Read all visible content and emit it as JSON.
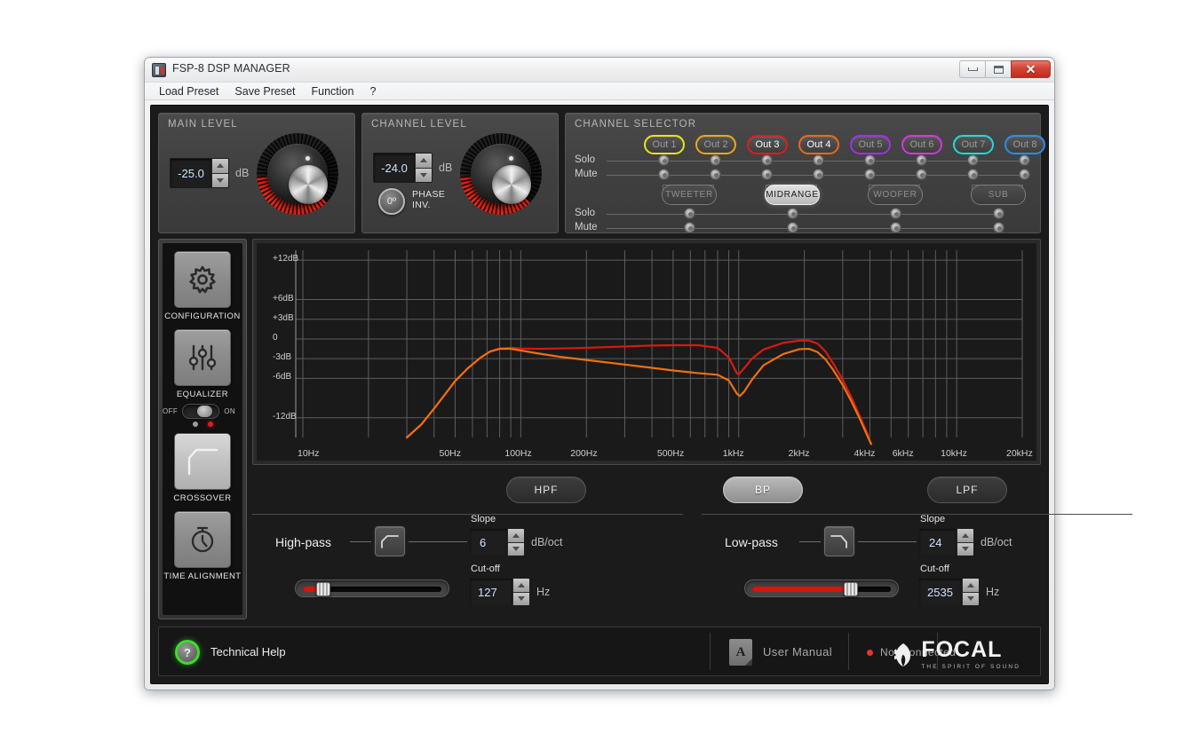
{
  "window": {
    "title": "FSP-8 DSP MANAGER",
    "icon": "app-icon",
    "controls": {
      "minimize": "minimize",
      "maximize": "maximize",
      "close": "✕"
    }
  },
  "menu": {
    "items": [
      "Load Preset",
      "Save Preset",
      "Function",
      "?"
    ]
  },
  "main_level": {
    "title": "MAIN LEVEL",
    "value": "-25.0",
    "unit": "dB"
  },
  "channel_level": {
    "title": "CHANNEL LEVEL",
    "value": "-24.0",
    "unit": "dB",
    "phase_value": "0º",
    "phase_label_line1": "PHASE",
    "phase_label_line2": "INV."
  },
  "channel_selector": {
    "title": "CHANNEL SELECTOR",
    "solo_label": "Solo",
    "mute_label": "Mute",
    "outputs": [
      {
        "label": "Out 1",
        "color": "#e8e21a",
        "active": false
      },
      {
        "label": "Out 2",
        "color": "#e8a81a",
        "active": false
      },
      {
        "label": "Out 3",
        "color": "#e01b1b",
        "active": true
      },
      {
        "label": "Out 4",
        "color": "#e86a18",
        "active": true
      },
      {
        "label": "Out 5",
        "color": "#a030e8",
        "active": false
      },
      {
        "label": "Out 6",
        "color": "#d634e0",
        "active": false
      },
      {
        "label": "Out 7",
        "color": "#1fd8e0",
        "active": false
      },
      {
        "label": "Out 8",
        "color": "#2a8de8",
        "active": false
      }
    ],
    "speakers": [
      {
        "label": "TWEETER",
        "active": false
      },
      {
        "label": "MIDRANGE",
        "active": true
      },
      {
        "label": "WOOFER",
        "active": false
      },
      {
        "label": "SUB",
        "active": false
      }
    ]
  },
  "sidebar": {
    "items": [
      {
        "label": "CONFIGURATION",
        "icon": "gear-icon",
        "selected": false
      },
      {
        "label": "EQUALIZER",
        "icon": "sliders-icon",
        "selected": false
      },
      {
        "label": "CROSSOVER",
        "icon": "crossover-curve-icon",
        "selected": true
      },
      {
        "label": "TIME ALIGNMENT",
        "icon": "stopwatch-icon",
        "selected": false
      }
    ],
    "eq_toggle": {
      "off_label": "OFF",
      "on_label": "ON",
      "state": "off"
    }
  },
  "chart_data": {
    "type": "line",
    "title": "",
    "xlabel": "",
    "ylabel": "",
    "grid": true,
    "x_scale": "log",
    "xlim": [
      10,
      20000
    ],
    "ylim": [
      -15,
      13.5
    ],
    "x_ticks": [
      "10Hz",
      "50Hz",
      "100Hz",
      "200Hz",
      "500Hz",
      "1kHz",
      "2kHz",
      "4kHz",
      "6kHz",
      "10kHz",
      "20kHz"
    ],
    "x_tick_values": [
      10,
      50,
      100,
      200,
      500,
      1000,
      2000,
      4000,
      6000,
      10000,
      20000
    ],
    "y_ticks": [
      "+12dB",
      "+6dB",
      "+3dB",
      "0",
      "-3dB",
      "-6dB",
      "-12dB"
    ],
    "y_tick_values": [
      12,
      6,
      3,
      0,
      -3,
      -6,
      -12
    ],
    "series": [
      {
        "name": "Out 3",
        "color": "#d81a10",
        "points": [
          [
            30,
            -15.0
          ],
          [
            35,
            -13.0
          ],
          [
            40,
            -10.6
          ],
          [
            45,
            -8.4
          ],
          [
            50,
            -6.4
          ],
          [
            57,
            -4.5
          ],
          [
            65,
            -2.9
          ],
          [
            72,
            -1.9
          ],
          [
            80,
            -1.45
          ],
          [
            90,
            -1.35
          ],
          [
            100,
            -1.45
          ],
          [
            120,
            -1.5
          ],
          [
            150,
            -1.45
          ],
          [
            200,
            -1.35
          ],
          [
            300,
            -1.15
          ],
          [
            400,
            -1.0
          ],
          [
            500,
            -0.95
          ],
          [
            650,
            -0.95
          ],
          [
            800,
            -1.35
          ],
          [
            900,
            -2.8
          ],
          [
            980,
            -5.2
          ],
          [
            1000,
            -5.4
          ],
          [
            1050,
            -4.6
          ],
          [
            1150,
            -3.0
          ],
          [
            1300,
            -1.6
          ],
          [
            1600,
            -0.6
          ],
          [
            1900,
            -0.25
          ],
          [
            2100,
            -0.25
          ],
          [
            2300,
            -0.7
          ],
          [
            2500,
            -1.9
          ],
          [
            2700,
            -3.6
          ],
          [
            3000,
            -6.2
          ],
          [
            3300,
            -9.0
          ],
          [
            3600,
            -11.8
          ],
          [
            3900,
            -14.5
          ],
          [
            4050,
            -16.0
          ]
        ]
      },
      {
        "name": "Out 4",
        "color": "#f07010",
        "points": [
          [
            30,
            -15.0
          ],
          [
            35,
            -13.0
          ],
          [
            40,
            -10.6
          ],
          [
            45,
            -8.4
          ],
          [
            50,
            -6.4
          ],
          [
            57,
            -4.5
          ],
          [
            65,
            -2.9
          ],
          [
            72,
            -1.95
          ],
          [
            80,
            -1.5
          ],
          [
            90,
            -1.5
          ],
          [
            100,
            -1.75
          ],
          [
            120,
            -2.2
          ],
          [
            150,
            -2.7
          ],
          [
            200,
            -3.2
          ],
          [
            300,
            -3.9
          ],
          [
            400,
            -4.4
          ],
          [
            500,
            -4.8
          ],
          [
            650,
            -5.2
          ],
          [
            800,
            -5.45
          ],
          [
            900,
            -6.3
          ],
          [
            980,
            -8.3
          ],
          [
            1010,
            -8.7
          ],
          [
            1060,
            -8.0
          ],
          [
            1150,
            -6.2
          ],
          [
            1300,
            -4.0
          ],
          [
            1600,
            -2.3
          ],
          [
            1900,
            -1.55
          ],
          [
            2100,
            -1.5
          ],
          [
            2300,
            -2.0
          ],
          [
            2500,
            -3.1
          ],
          [
            2700,
            -4.6
          ],
          [
            3000,
            -7.0
          ],
          [
            3300,
            -9.6
          ],
          [
            3600,
            -12.2
          ],
          [
            3900,
            -14.8
          ],
          [
            4050,
            -16.0
          ]
        ]
      }
    ]
  },
  "filter_buttons": [
    {
      "label": "HPF",
      "active": false
    },
    {
      "label": "BP",
      "active": true
    },
    {
      "label": "LPF",
      "active": false
    }
  ],
  "highpass": {
    "label": "High-pass",
    "icon": "highpass-slope-icon",
    "slope_label": "Slope",
    "slope_value": "6",
    "slope_unit": "dB/oct",
    "cutoff_label": "Cut-off",
    "cutoff_value": "127",
    "cutoff_unit": "Hz",
    "slider_position": 12
  },
  "lowpass": {
    "label": "Low-pass",
    "icon": "lowpass-slope-icon",
    "slope_label": "Slope",
    "slope_value": "24",
    "slope_unit": "dB/oct",
    "cutoff_label": "Cut-off",
    "cutoff_value": "2535",
    "cutoff_unit": "Hz",
    "slider_position": 68
  },
  "footer": {
    "help_glyph": "?",
    "help_label": "Technical Help",
    "manual_label": "User Manual",
    "manual_icon": "pdf-icon",
    "connection_status": "Not Connected",
    "connection_color": "#e8372a",
    "brand_name": "FOCAL",
    "brand_tagline": "THE SPIRIT OF SOUND"
  }
}
